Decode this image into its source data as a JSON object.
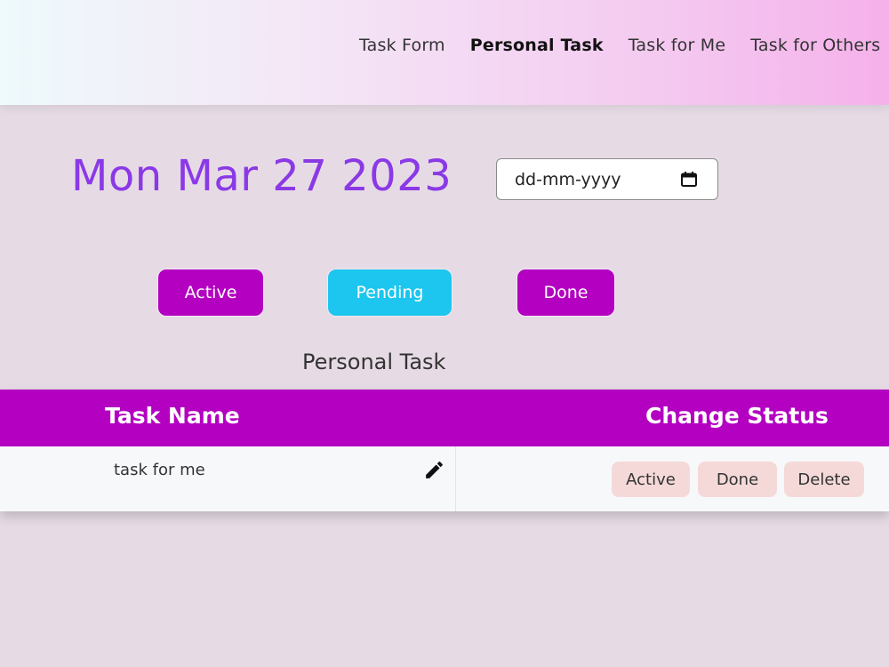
{
  "nav": {
    "links": [
      "Task Form",
      "Personal Task",
      "Task for Me",
      "Task for Others"
    ],
    "active_index": 1
  },
  "header": {
    "date": "Mon Mar 27 2023",
    "date_picker_placeholder": "dd-mm-yyyy"
  },
  "filters": {
    "active_label": "Active",
    "pending_label": "Pending",
    "done_label": "Done"
  },
  "section": {
    "title": "Personal Task"
  },
  "table": {
    "columns": [
      "Task Name",
      "Change Status"
    ],
    "rows": [
      {
        "task_name": "task for me",
        "actions": [
          "Active",
          "Done",
          "Delete"
        ]
      }
    ]
  },
  "colors": {
    "accent_purple": "#b300c1",
    "pending_cyan": "#1cc6ee",
    "date_purple": "#8b39e6",
    "row_button_bg": "#f5d9d9"
  },
  "icons": {
    "edit": "pencil-icon",
    "calendar": "calendar-icon"
  }
}
